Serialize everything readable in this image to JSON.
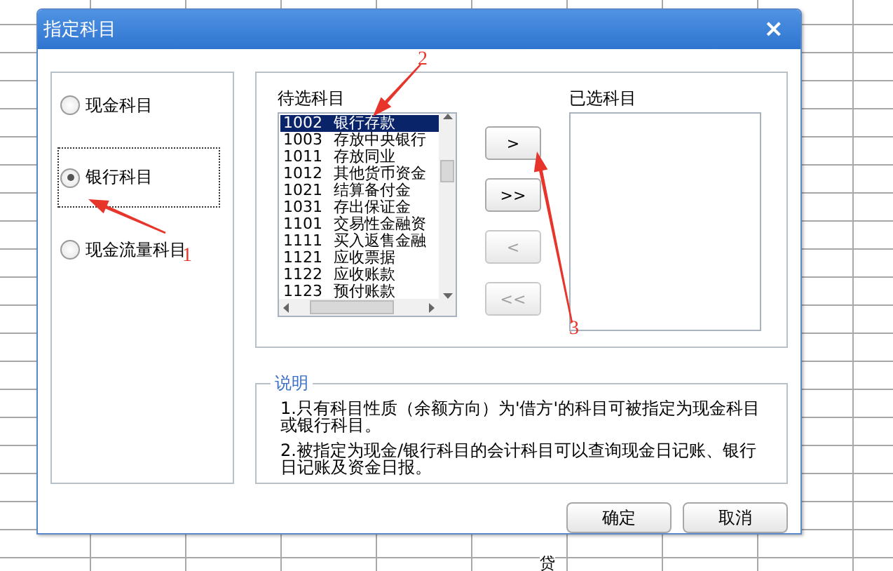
{
  "sheet": {
    "bottom_text": "贷"
  },
  "dialog": {
    "title": "指定科目",
    "close": "×",
    "radios": [
      {
        "label": "现金科目",
        "selected": false,
        "focused": false
      },
      {
        "label": "银行科目",
        "selected": true,
        "focused": true
      },
      {
        "label": "现金流量科目",
        "selected": false,
        "focused": false
      }
    ],
    "candidates": {
      "label": "待选科目",
      "items": [
        {
          "code": "1002",
          "name": "银行存款",
          "selected": true
        },
        {
          "code": "1003",
          "name": "存放中央银行",
          "selected": false
        },
        {
          "code": "1011",
          "name": "存放同业",
          "selected": false
        },
        {
          "code": "1012",
          "name": "其他货币资金",
          "selected": false
        },
        {
          "code": "1021",
          "name": "结算备付金",
          "selected": false
        },
        {
          "code": "1031",
          "name": "存出保证金",
          "selected": false
        },
        {
          "code": "1101",
          "name": "交易性金融资",
          "selected": false
        },
        {
          "code": "1111",
          "name": "买入返售金融",
          "selected": false
        },
        {
          "code": "1121",
          "name": "应收票据",
          "selected": false
        },
        {
          "code": "1122",
          "name": "应收账款",
          "selected": false
        },
        {
          "code": "1123",
          "name": "预付账款",
          "selected": false
        }
      ]
    },
    "transfer_buttons": [
      {
        "label": ">",
        "disabled": false
      },
      {
        "label": ">>",
        "disabled": false
      },
      {
        "label": "<",
        "disabled": true
      },
      {
        "label": "<<",
        "disabled": true
      }
    ],
    "chosen": {
      "label": "已选科目"
    },
    "notes": {
      "legend": "说明",
      "items": [
        "1.只有科目性质（余额方向）为'借方'的科目可被指定为现金科目或银行科目。",
        "2.被指定为现金/银行科目的会计科目可以查询现金日记账、银行日记账及资金日报。"
      ]
    },
    "buttons": [
      {
        "label": "确定"
      },
      {
        "label": "取消"
      }
    ]
  },
  "annotations": [
    {
      "number": "1"
    },
    {
      "number": "2"
    },
    {
      "number": "3"
    }
  ]
}
